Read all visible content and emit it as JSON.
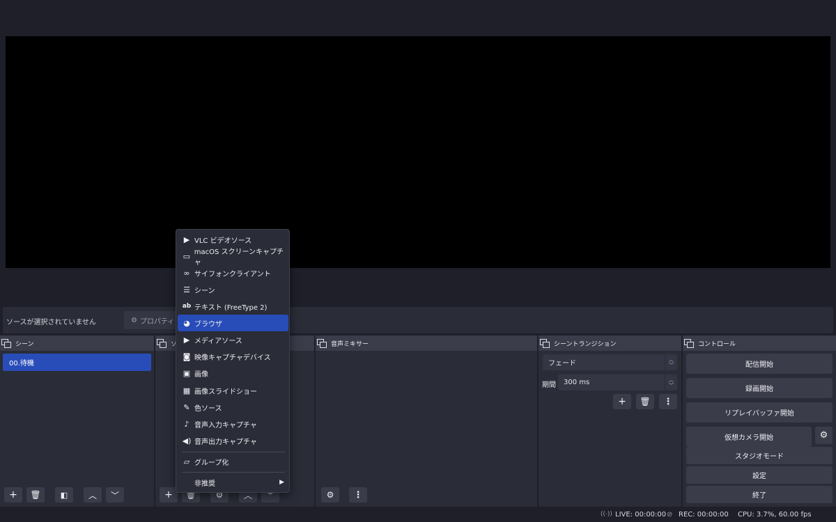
{
  "colors": {
    "background": "#1e1f29",
    "panel": "#2a2c37",
    "panel_header": "#3a3c4a",
    "accent": "#284cb8",
    "preview": "#000000"
  },
  "source_bar": {
    "no_selection": "ソースが選択されていません",
    "properties_label": "プロパティ"
  },
  "scenes": {
    "title": "シーン",
    "items": [
      "00.待機"
    ]
  },
  "sources": {
    "title": "ソ"
  },
  "audio_mixer": {
    "title": "音声ミキサー"
  },
  "transitions": {
    "title": "シーントランジション",
    "selected": "フェード",
    "duration_label": "期間",
    "duration_value": "300 ms"
  },
  "controls": {
    "title": "コントロール",
    "start_streaming": "配信開始",
    "start_recording": "録画開始",
    "start_replay_buffer": "リプレイバッファ開始",
    "start_virtual_camera": "仮想カメラ開始",
    "studio_mode": "スタジオモード",
    "settings": "設定",
    "exit": "終了"
  },
  "add_source_menu": {
    "items": [
      {
        "label": "VLC ビデオソース",
        "icon": "play-icon"
      },
      {
        "label": "macOS スクリーンキャプチャ",
        "icon": "monitor-icon"
      },
      {
        "label": "サイフォンクライアント",
        "icon": "gamepad-icon"
      },
      {
        "label": "シーン",
        "icon": "list-icon"
      },
      {
        "label": "テキスト (FreeType 2)",
        "icon": "text-icon"
      },
      {
        "label": "ブラウザ",
        "icon": "globe-icon",
        "selected": true
      },
      {
        "label": "メディアソース",
        "icon": "play-icon"
      },
      {
        "label": "映像キャプチャデバイス",
        "icon": "camera-icon"
      },
      {
        "label": "画像",
        "icon": "image-icon"
      },
      {
        "label": "画像スライドショー",
        "icon": "slideshow-icon"
      },
      {
        "label": "色ソース",
        "icon": "brush-icon"
      },
      {
        "label": "音声入力キャプチャ",
        "icon": "microphone-icon"
      },
      {
        "label": "音声出力キャプチャ",
        "icon": "speaker-icon"
      }
    ],
    "group_label": "グループ化",
    "deprecated_label": "非推奨"
  },
  "status": {
    "live": "LIVE: 00:00:00",
    "rec": "REC: 00:00:00",
    "cpu": "CPU: 3.7%, 60.00 fps"
  }
}
